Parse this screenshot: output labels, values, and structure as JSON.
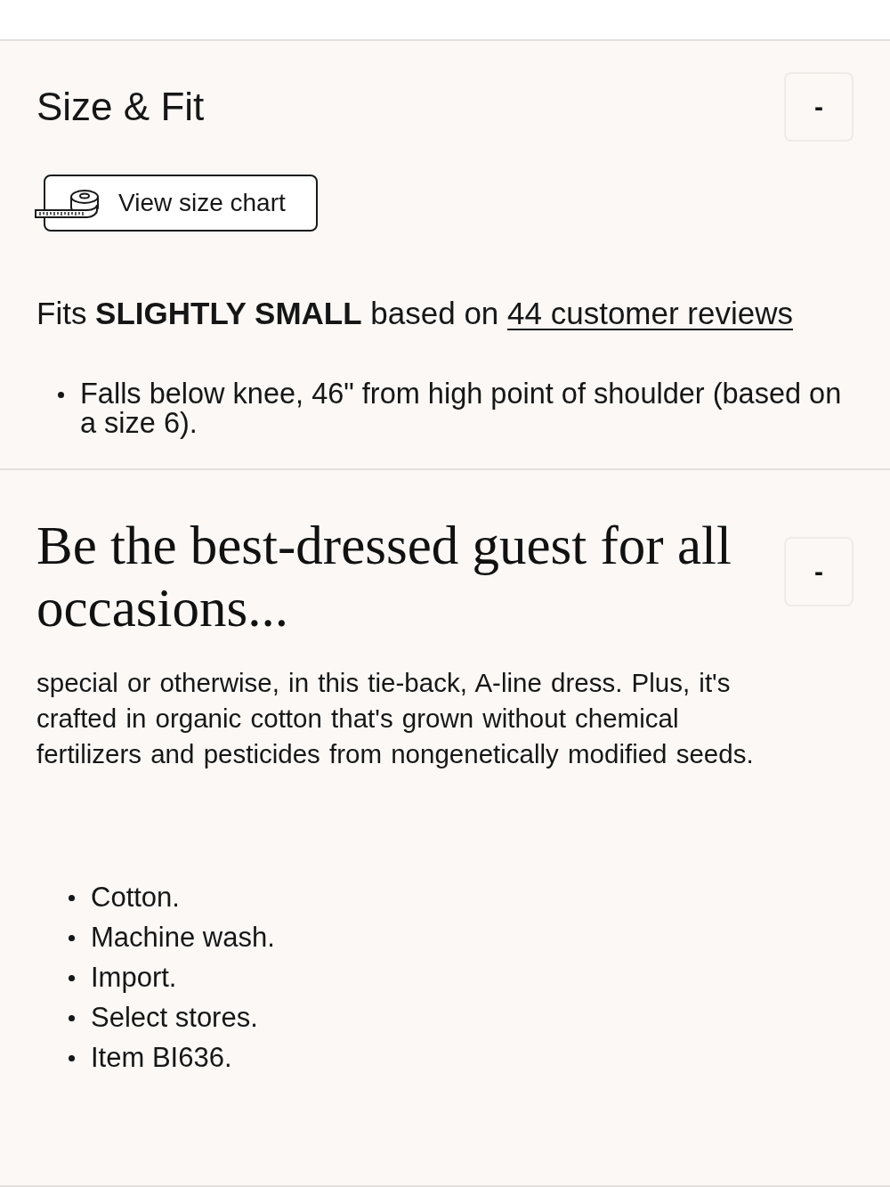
{
  "sections": [
    {
      "kind": "size_fit",
      "title": "Size & Fit",
      "toggle": "-",
      "size_chart_button": "View size chart",
      "fit_summary": {
        "text": "Fits **SLIGHTLY SMALL** based on",
        "link": "44 customer reviews"
      },
      "notes": [
        "Falls below knee, 46\" from high point of shoulder (based on a size 6)."
      ]
    },
    {
      "kind": "description",
      "title": "Be the best-dressed guest for all occasions...",
      "toggle": "-",
      "body": "special or otherwise, in this tie-back, A-line dress. Plus, it's crafted in organic cotton that's grown without chemical fertilizers and pesticides from nongenetically modified seeds.",
      "details": [
        "Cotton.",
        "Machine wash.",
        "Import.",
        "Select stores.",
        "Item BI636."
      ]
    }
  ]
}
